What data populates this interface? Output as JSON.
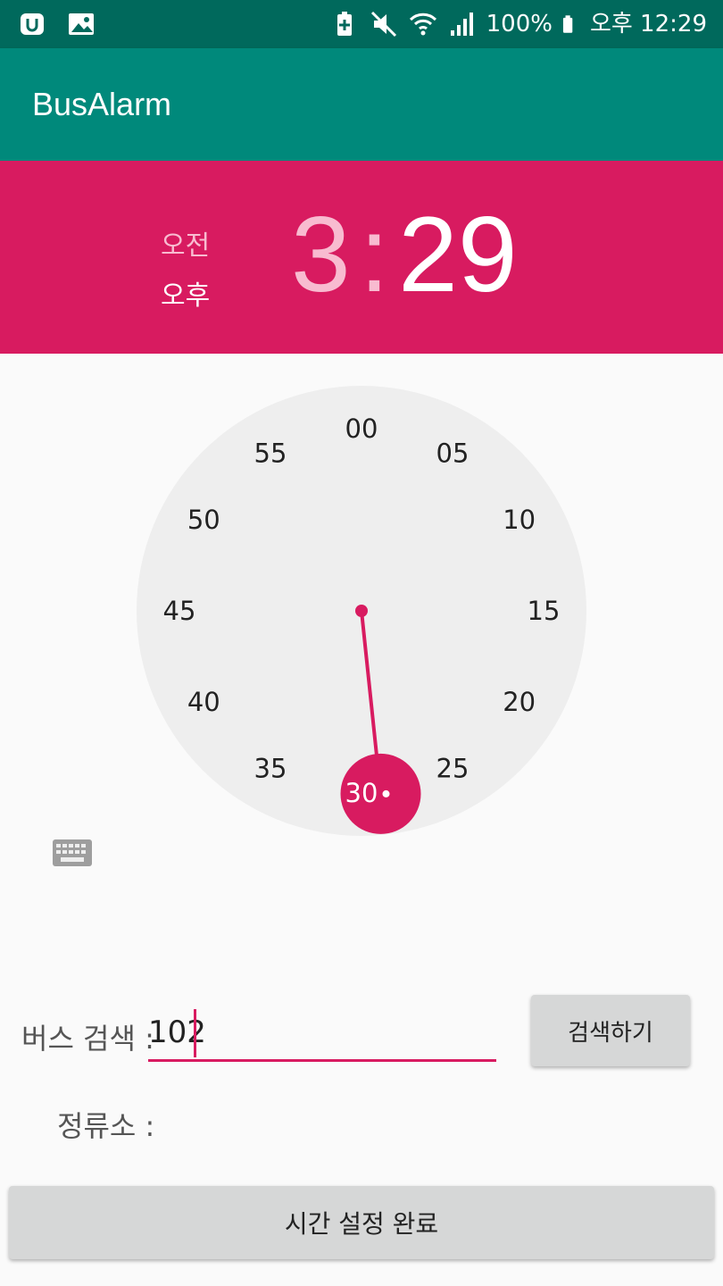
{
  "status_bar": {
    "battery": "100%",
    "time": "오후 12:29",
    "icons": [
      "app-icon",
      "gallery-icon",
      "battery-saver-icon",
      "mute-icon",
      "wifi-icon",
      "signal-icon",
      "battery-icon"
    ]
  },
  "app": {
    "title": "BusAlarm"
  },
  "time_picker": {
    "am_label": "오전",
    "pm_label": "오후",
    "selected_period": "오후",
    "hour": "3",
    "separator": ":",
    "minute": "29",
    "dial_labels": [
      "00",
      "05",
      "10",
      "15",
      "20",
      "25",
      "30",
      "35",
      "40",
      "45",
      "50",
      "55"
    ],
    "selected_dial_value": "30",
    "hand_minute": 29,
    "accent_color": "#d81b60"
  },
  "search": {
    "label": "버스 검색 :",
    "value": "102",
    "button_label": "검색하기"
  },
  "stop": {
    "label": "정류소 :"
  },
  "complete_button": {
    "label": "시간 설정 완료"
  },
  "colors": {
    "status_bar": "#00695c",
    "app_bar": "#00897b",
    "accent": "#d81b60",
    "dial": "#eeeeee"
  }
}
